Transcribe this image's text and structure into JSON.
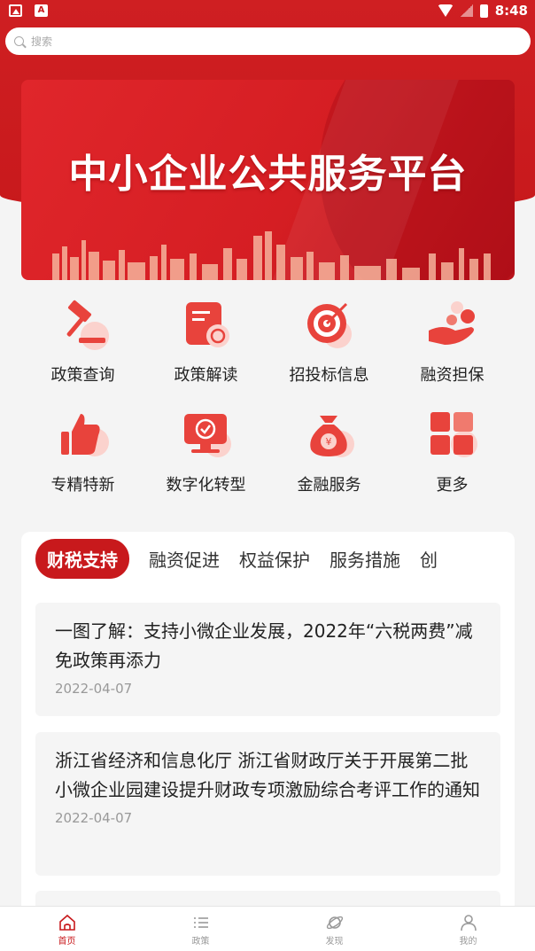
{
  "status_bar": {
    "time": "8:48"
  },
  "search": {
    "placeholder": "搜索"
  },
  "banner": {
    "title": "中小企业公共服务平台"
  },
  "grid": [
    {
      "label": "政策查询",
      "icon": "gavel-icon"
    },
    {
      "label": "政策解读",
      "icon": "document-icon"
    },
    {
      "label": "招投标信息",
      "icon": "target-icon"
    },
    {
      "label": "融资担保",
      "icon": "hand-coins-icon"
    },
    {
      "label": "专精特新",
      "icon": "thumbs-up-icon"
    },
    {
      "label": "数字化转型",
      "icon": "monitor-icon"
    },
    {
      "label": "金融服务",
      "icon": "money-bag-icon"
    },
    {
      "label": "更多",
      "icon": "grid-more-icon"
    }
  ],
  "tabs": [
    "财税支持",
    "融资促进",
    "权益保护",
    "服务措施",
    "创"
  ],
  "news": [
    {
      "title": "一图了解：支持小微企业发展，2022年“六税两费”减免政策再添力",
      "date": "2022-04-07"
    },
    {
      "title": "浙江省经济和信息化厅 浙江省财政厅关于开展第二批小微企业园建设提升财政专项激励综合考评工作的通知",
      "date": "2022-04-07"
    }
  ],
  "bottom_nav": [
    {
      "label": "首页",
      "icon": "home-icon",
      "active": true
    },
    {
      "label": "政策",
      "icon": "list-icon",
      "active": false
    },
    {
      "label": "发现",
      "icon": "planet-icon",
      "active": false
    },
    {
      "label": "我的",
      "icon": "user-icon",
      "active": false
    }
  ],
  "colors": {
    "brand_red": "#c8191c",
    "icon_red": "#e8433c",
    "icon_pink": "#fbd2cd"
  }
}
